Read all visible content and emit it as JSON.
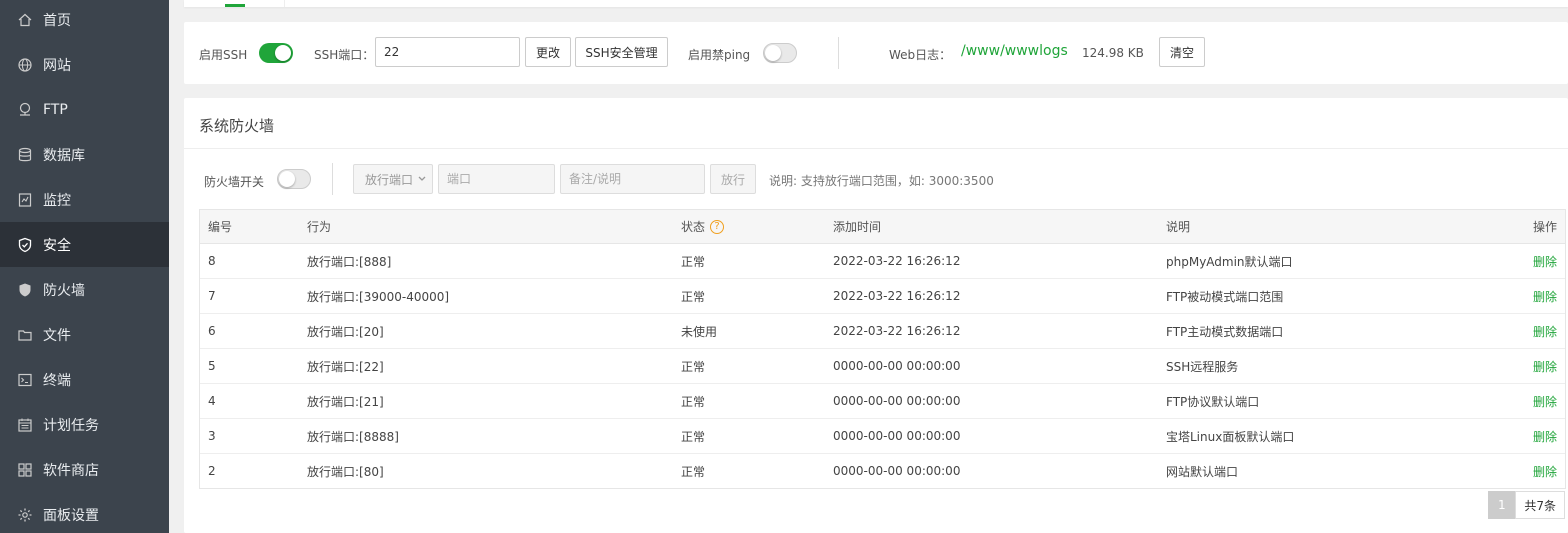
{
  "sidebar": {
    "items": [
      {
        "label": "首页",
        "icon": "home-icon",
        "active": false
      },
      {
        "label": "网站",
        "icon": "globe-icon",
        "active": false
      },
      {
        "label": "FTP",
        "icon": "ftp-icon",
        "active": false
      },
      {
        "label": "数据库",
        "icon": "database-icon",
        "active": false
      },
      {
        "label": "监控",
        "icon": "monitor-icon",
        "active": false
      },
      {
        "label": "安全",
        "icon": "shield-check-icon",
        "active": true
      },
      {
        "label": "防火墙",
        "icon": "shield-icon",
        "active": false
      },
      {
        "label": "文件",
        "icon": "folder-icon",
        "active": false
      },
      {
        "label": "终端",
        "icon": "terminal-icon",
        "active": false
      },
      {
        "label": "计划任务",
        "icon": "calendar-icon",
        "active": false
      },
      {
        "label": "软件商店",
        "icon": "grid-icon",
        "active": false
      },
      {
        "label": "面板设置",
        "icon": "gear-icon",
        "active": false
      }
    ]
  },
  "ssh": {
    "enable_label": "启用SSH",
    "enabled": true,
    "port_label": "SSH端口：",
    "port_value": "22",
    "change_label": "更改",
    "manage_label": "SSH安全管理",
    "ping_label": "启用禁ping",
    "ping_enabled": false,
    "weblog_label": "Web日志：",
    "weblog_path": "/www/wwwlogs",
    "weblog_size": "124.98 KB",
    "clear_label": "清空"
  },
  "firewall": {
    "title": "系统防火墙",
    "switch_label": "防火墙开关",
    "switch_on": false,
    "select_value": "放行端口",
    "port_placeholder": "端口",
    "note_placeholder": "备注/说明",
    "allow_label": "放行",
    "hint": "说明: 支持放行端口范围，如: 3000:3500",
    "columns": {
      "id": "编号",
      "action": "行为",
      "status": "状态",
      "time": "添加时间",
      "desc": "说明",
      "op": "操作"
    },
    "status_help": "?",
    "rows": [
      {
        "id": "8",
        "action": "放行端口:[888]",
        "status": "正常",
        "time": "2022-03-22 16:26:12",
        "desc": "phpMyAdmin默认端口",
        "op": "删除"
      },
      {
        "id": "7",
        "action": "放行端口:[39000-40000]",
        "status": "正常",
        "time": "2022-03-22 16:26:12",
        "desc": "FTP被动模式端口范围",
        "op": "删除"
      },
      {
        "id": "6",
        "action": "放行端口:[20]",
        "status": "未使用",
        "time": "2022-03-22 16:26:12",
        "desc": "FTP主动模式数据端口",
        "op": "删除"
      },
      {
        "id": "5",
        "action": "放行端口:[22]",
        "status": "正常",
        "time": "0000-00-00 00:00:00",
        "desc": "SSH远程服务",
        "op": "删除"
      },
      {
        "id": "4",
        "action": "放行端口:[21]",
        "status": "正常",
        "time": "0000-00-00 00:00:00",
        "desc": "FTP协议默认端口",
        "op": "删除"
      },
      {
        "id": "3",
        "action": "放行端口:[8888]",
        "status": "正常",
        "time": "0000-00-00 00:00:00",
        "desc": "宝塔Linux面板默认端口",
        "op": "删除"
      },
      {
        "id": "2",
        "action": "放行端口:[80]",
        "status": "正常",
        "time": "0000-00-00 00:00:00",
        "desc": "网站默认端口",
        "op": "删除"
      }
    ],
    "pager": {
      "current": "1",
      "total": "共7条"
    }
  },
  "colors": {
    "accent": "#20a53a",
    "sidebar_bg": "#3c444d",
    "sidebar_active": "#2c3138"
  }
}
